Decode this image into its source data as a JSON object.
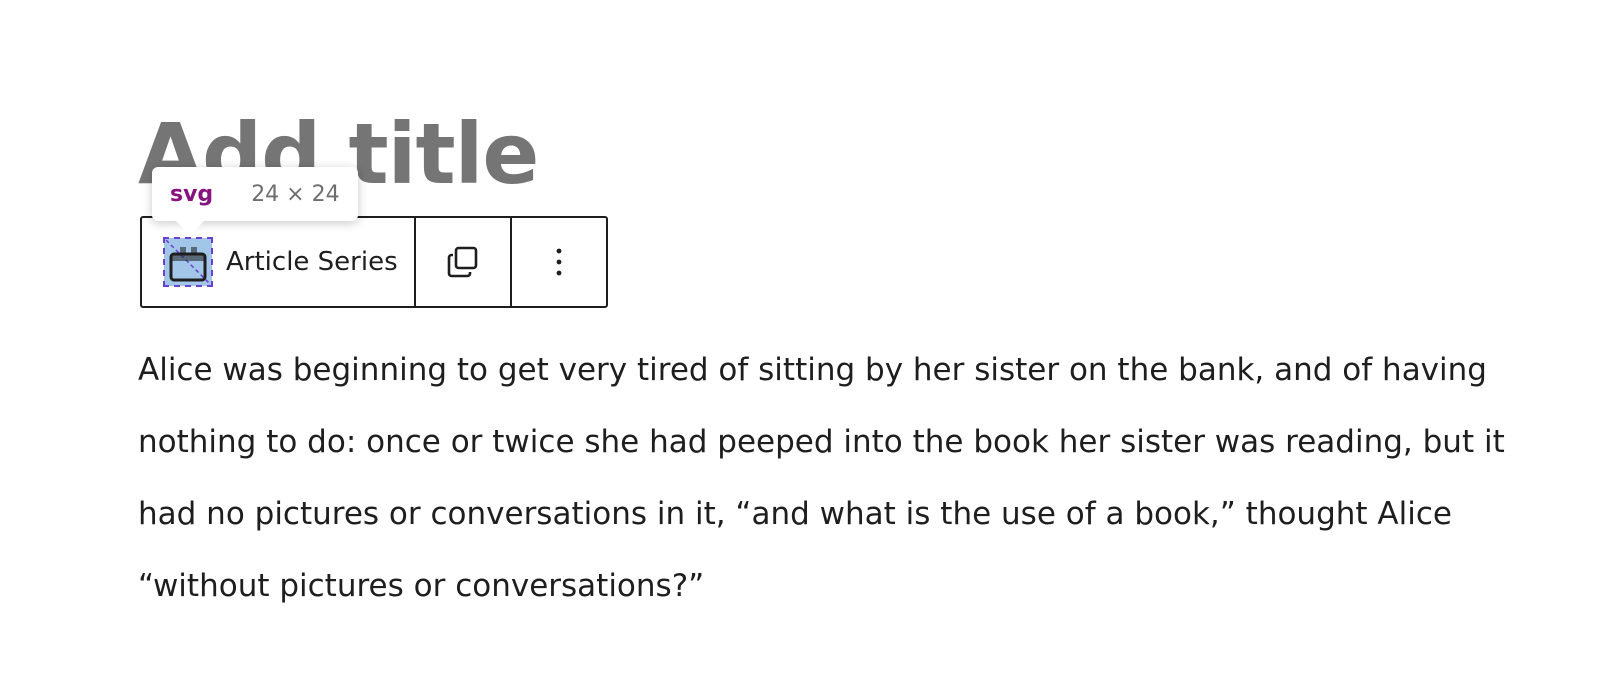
{
  "post": {
    "title_placeholder": "Add title",
    "paragraph": "Alice was beginning to get very tired of sitting by her sister on the bank, and of having nothing to do: once or twice she had peeped into the book her sister was reading, but it had no pictures or conversations in it, “and what is the use of a book,” thought Alice “without pictures or conversations?”"
  },
  "toolbar": {
    "block_name": "Article Series",
    "block_icon": "calendar-icon",
    "duplicate_icon": "duplicate-icon",
    "options_icon": "more-vertical-icon"
  },
  "inspector": {
    "tag": "svg",
    "size": "24 × 24"
  },
  "colors": {
    "text": "#1e1e1e",
    "placeholder": "#757575",
    "highlight_fill": "#6fa8dc",
    "highlight_border": "#6a3fd4",
    "tag_color": "#881280"
  }
}
